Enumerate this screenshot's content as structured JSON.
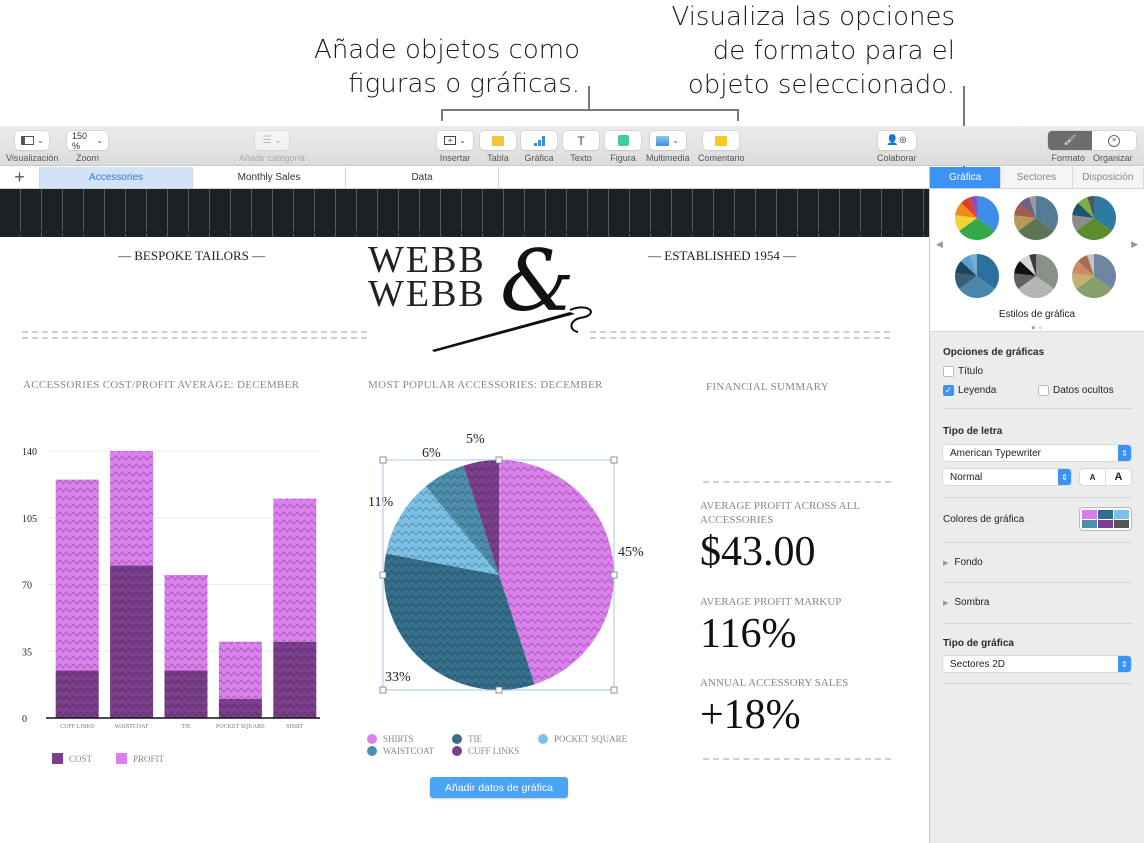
{
  "callouts": {
    "insert_objects": [
      "Añade objetos como",
      "figuras o gráficas."
    ],
    "format_options": [
      "Visualiza las opciones",
      "de formato para el",
      "objeto seleccionado."
    ]
  },
  "toolbar": {
    "view_label": "Visualización",
    "zoom_value": "150 %",
    "zoom_label": "Zoom",
    "add_category_label": "Añadir categoría",
    "insert_label": "Insertar",
    "table_label": "Tabla",
    "chart_label": "Gráfica",
    "text_label": "Texto",
    "shape_label": "Figura",
    "media_label": "Multimedia",
    "comment_label": "Comentario",
    "collaborate_label": "Colaborar",
    "format_label": "Formato",
    "organize_label": "Organizar",
    "colors": {
      "table": "#f6c33b",
      "chart": "#3a8ee6",
      "shape": "#3fcf8e",
      "comment": "#f7c923"
    }
  },
  "sheet_tabs": [
    {
      "label": "Accessories",
      "active": true
    },
    {
      "label": "Monthly Sales",
      "active": false
    },
    {
      "label": "Data",
      "active": false
    }
  ],
  "inspector": {
    "tabs": [
      {
        "label": "Gráfica",
        "active": true
      },
      {
        "label": "Sectores",
        "active": false
      },
      {
        "label": "Disposición",
        "active": false
      }
    ],
    "styles_caption": "Estilos de gráfica",
    "styles_page": "1 de 2",
    "chart_options_title": "Opciones de gráficas",
    "title_checkbox": {
      "label": "Título",
      "checked": false
    },
    "legend_checkbox": {
      "label": "Leyenda",
      "checked": true
    },
    "hidden_data_checkbox": {
      "label": "Datos ocultos",
      "checked": false
    },
    "font_title": "Tipo de letra",
    "font_name": "American Typewriter",
    "font_style": "Normal",
    "font_smaller": "A",
    "font_larger": "A",
    "chart_colors_label": "Colores de gráfica",
    "chart_colors": [
      "#d97ce8",
      "#2f6e8f",
      "#7cc0e6",
      "#4b8fb1",
      "#7a3f8f",
      "#555555"
    ],
    "background_label": "Fondo",
    "shadow_label": "Sombra",
    "chart_type_title": "Tipo de gráfica",
    "chart_type_value": "Sectores 2D"
  },
  "document": {
    "tagline_left": "— BESPOKE TAILORS —",
    "tagline_right": "— ESTABLISHED 1954 —",
    "logo_line1": "WEBB",
    "logo_line2": "WEBB",
    "logo_amp": "&",
    "bar_chart_title": "ACCESSORIES COST/PROFIT AVERAGE: DECEMBER",
    "pie_chart_title": "MOST POPULAR ACCESSORIES: DECEMBER",
    "summary_title": "FINANCIAL SUMMARY",
    "kpis": [
      {
        "label": "AVERAGE PROFIT ACROSS ALL ACCESSORIES",
        "value": "$43.00"
      },
      {
        "label": "AVERAGE PROFIT MARKUP",
        "value": "116%"
      },
      {
        "label": "ANNUAL ACCESSORY SALES",
        "value": "+18%"
      }
    ],
    "add_chart_data_button": "Añadir datos de gráfica"
  },
  "chart_data": [
    {
      "type": "bar",
      "stacked": true,
      "title": "ACCESSORIES COST/PROFIT AVERAGE: DECEMBER",
      "categories": [
        "CUFF LINKS",
        "WAISTCOAT",
        "TIE",
        "POCKET SQUARE",
        "SHIRT"
      ],
      "series": [
        {
          "name": "COST",
          "color": "#7b3f8e",
          "values": [
            25,
            80,
            25,
            10,
            40
          ]
        },
        {
          "name": "PROFIT",
          "color": "#dd80ef",
          "values": [
            100,
            60,
            50,
            30,
            75
          ]
        }
      ],
      "yticks": [
        0,
        35,
        70,
        105,
        140
      ],
      "ylim": [
        0,
        140
      ],
      "grid": true,
      "legend": "bottom-left"
    },
    {
      "type": "pie",
      "title": "MOST POPULAR ACCESSORIES: DECEMBER",
      "slices": [
        {
          "name": "SHIRTS",
          "value": 45,
          "label": "45%",
          "color": "#dd80ef"
        },
        {
          "name": "TIE",
          "value": 33,
          "label": "33%",
          "color": "#356f8c"
        },
        {
          "name": "POCKET SQUARE",
          "value": 11,
          "label": "11%",
          "color": "#7cc2e8"
        },
        {
          "name": "WAISTCOAT",
          "value": 6,
          "label": "6%",
          "color": "#4f8fae"
        },
        {
          "name": "CUFF LINKS",
          "value": 5,
          "label": "5%",
          "color": "#7b3f8e"
        }
      ],
      "legend_order": [
        "SHIRTS",
        "TIE",
        "POCKET SQUARE",
        "WAISTCOAT",
        "CUFF LINKS"
      ],
      "legend": "bottom",
      "selected": true
    }
  ]
}
